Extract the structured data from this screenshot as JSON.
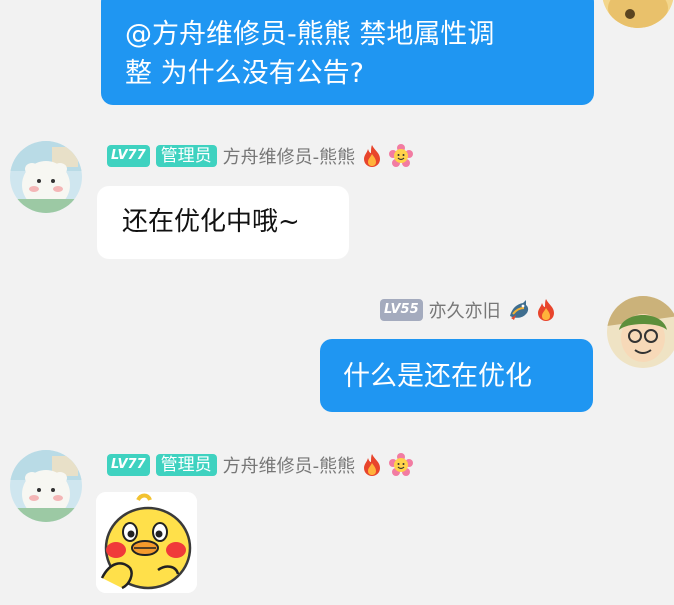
{
  "messages": [
    {
      "side": "right",
      "text_line1": "@方舟维修员-熊熊 禁地属性调",
      "text_line2": "整 为什么没有公告?"
    },
    {
      "side": "left",
      "level": "LV77",
      "role": "管理员",
      "nickname": "方舟维修员-熊熊",
      "badges": [
        "fire-icon",
        "flower-face-icon"
      ],
      "text": "还在优化中哦~"
    },
    {
      "side": "right",
      "level": "LV55",
      "nickname": "亦久亦旧",
      "badges": [
        "dragon-icon",
        "fire-icon"
      ],
      "text": "什么是还在优化"
    },
    {
      "side": "left",
      "level": "LV77",
      "role": "管理员",
      "nickname": "方舟维修员-熊熊",
      "badges": [
        "fire-icon",
        "flower-face-icon"
      ],
      "sticker": "yellow-duck-sticker"
    }
  ],
  "colors": {
    "background": "#f2f2f2",
    "outgoing_bubble": "#1f96f2",
    "incoming_bubble": "#ffffff",
    "admin_tag": "#3fd2c0",
    "level_tag_gray": "#a4abbe"
  }
}
